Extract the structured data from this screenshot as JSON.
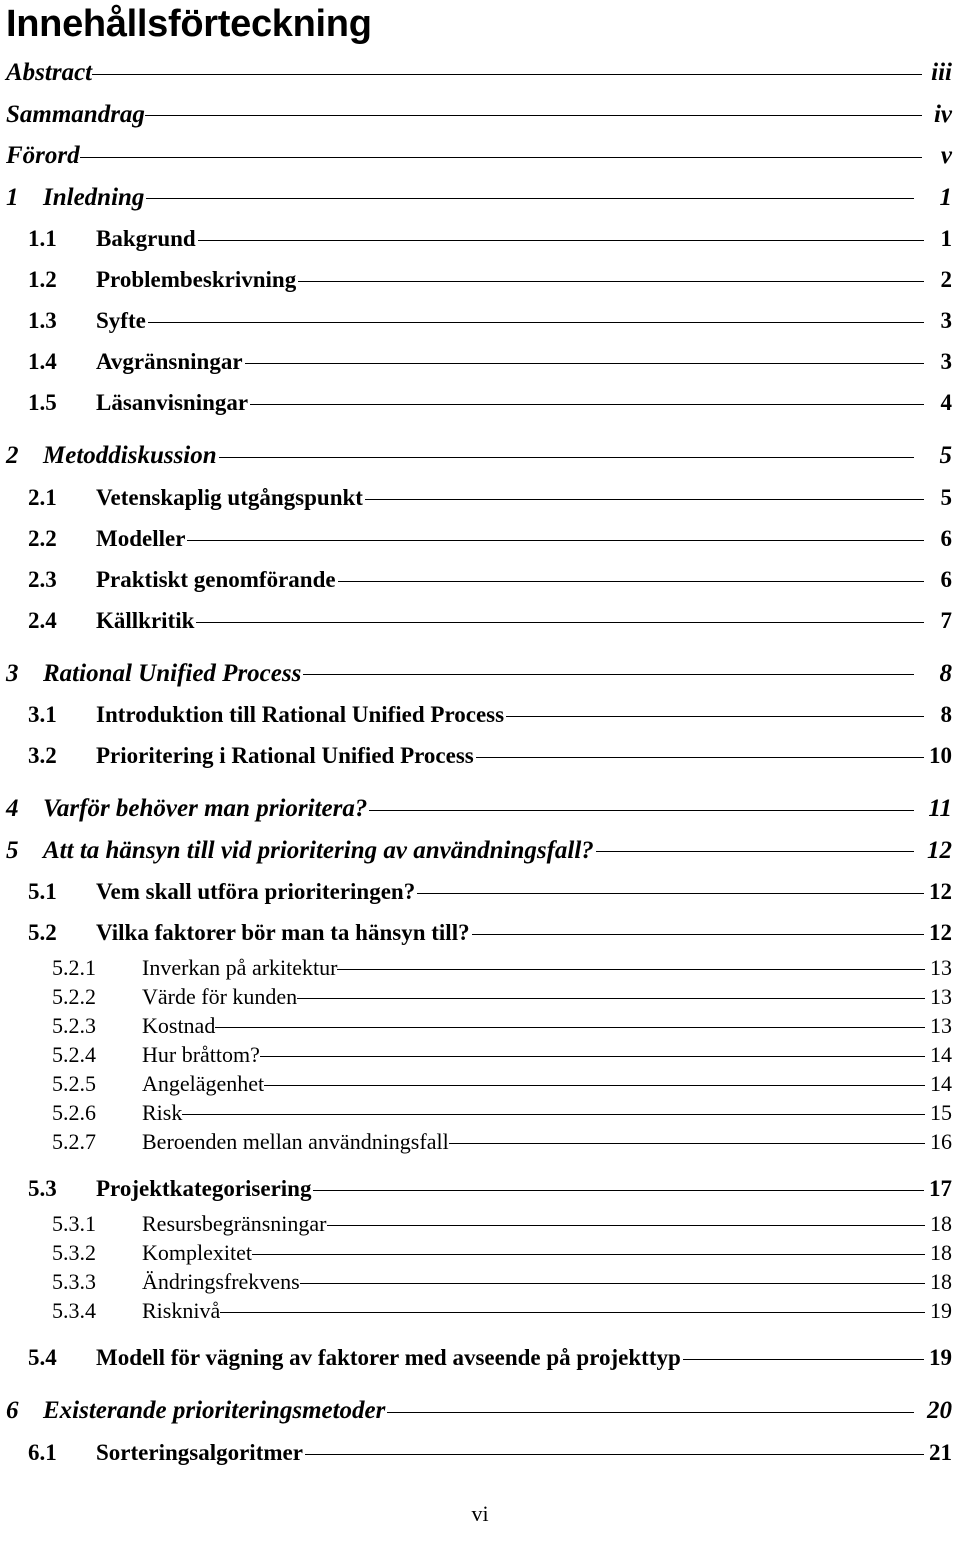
{
  "document": {
    "title": "Innehållsförteckning",
    "footer_page_number": "vi"
  },
  "toc": {
    "entries": [
      {
        "level": 0,
        "number": "",
        "label": "Abstract",
        "page": "iii"
      },
      {
        "level": 0,
        "number": "",
        "label": "Sammandrag",
        "page": "iv"
      },
      {
        "level": 0,
        "number": "",
        "label": "Förord",
        "page": "v"
      },
      {
        "level": 1,
        "number": "1",
        "label": "Inledning",
        "page": "1"
      },
      {
        "level": 2,
        "number": "1.1",
        "label": "Bakgrund",
        "page": "1"
      },
      {
        "level": 2,
        "number": "1.2",
        "label": "Problembeskrivning",
        "page": "2"
      },
      {
        "level": 2,
        "number": "1.3",
        "label": "Syfte",
        "page": "3"
      },
      {
        "level": 2,
        "number": "1.4",
        "label": "Avgränsningar",
        "page": "3"
      },
      {
        "level": 2,
        "number": "1.5",
        "label": "Läsanvisningar",
        "page": "4"
      },
      {
        "level": 1,
        "number": "2",
        "label": "Metoddiskussion",
        "page": "5"
      },
      {
        "level": 2,
        "number": "2.1",
        "label": "Vetenskaplig utgångspunkt",
        "page": "5"
      },
      {
        "level": 2,
        "number": "2.2",
        "label": "Modeller",
        "page": "6"
      },
      {
        "level": 2,
        "number": "2.3",
        "label": "Praktiskt genomförande",
        "page": "6"
      },
      {
        "level": 2,
        "number": "2.4",
        "label": "Källkritik",
        "page": "7"
      },
      {
        "level": 1,
        "number": "3",
        "label": "Rational Unified Process",
        "page": "8"
      },
      {
        "level": 2,
        "number": "3.1",
        "label": "Introduktion till Rational Unified Process",
        "page": "8"
      },
      {
        "level": 2,
        "number": "3.2",
        "label": "Prioritering i Rational Unified Process",
        "page": "10"
      },
      {
        "level": 1,
        "number": "4",
        "label": "Varför behöver man prioritera?",
        "page": "11"
      },
      {
        "level": 1,
        "number": "5",
        "label": "Att ta hänsyn till vid prioritering av användningsfall?",
        "page": "12"
      },
      {
        "level": 2,
        "number": "5.1",
        "label": "Vem skall utföra prioriteringen?",
        "page": "12"
      },
      {
        "level": 2,
        "number": "5.2",
        "label": "Vilka faktorer bör man ta hänsyn till?",
        "page": "12"
      },
      {
        "level": 3,
        "number": "5.2.1",
        "label": "Inverkan på arkitektur",
        "page": "13"
      },
      {
        "level": 3,
        "number": "5.2.2",
        "label": "Värde för kunden",
        "page": "13"
      },
      {
        "level": 3,
        "number": "5.2.3",
        "label": "Kostnad",
        "page": "13"
      },
      {
        "level": 3,
        "number": "5.2.4",
        "label": "Hur bråttom?",
        "page": "14"
      },
      {
        "level": 3,
        "number": "5.2.5",
        "label": "Angelägenhet",
        "page": "14"
      },
      {
        "level": 3,
        "number": "5.2.6",
        "label": "Risk",
        "page": "15"
      },
      {
        "level": 3,
        "number": "5.2.7",
        "label": "Beroenden mellan användningsfall",
        "page": "16"
      },
      {
        "level": 2,
        "number": "5.3",
        "label": "Projektkategorisering",
        "page": "17"
      },
      {
        "level": 3,
        "number": "5.3.1",
        "label": "Resursbegränsningar",
        "page": "18"
      },
      {
        "level": 3,
        "number": "5.3.2",
        "label": "Komplexitet",
        "page": "18"
      },
      {
        "level": 3,
        "number": "5.3.3",
        "label": "Ändringsfrekvens",
        "page": "18"
      },
      {
        "level": 3,
        "number": "5.3.4",
        "label": "Risknivå",
        "page": "19"
      },
      {
        "level": 2,
        "number": "5.4",
        "label": "Modell för vägning av faktorer med avseende på projekttyp",
        "page": "19"
      },
      {
        "level": 1,
        "number": "6",
        "label": "Existerande prioriteringsmetoder",
        "page": "20"
      },
      {
        "level": 2,
        "number": "6.1",
        "label": "Sorteringsalgoritmer",
        "page": "21"
      }
    ]
  }
}
